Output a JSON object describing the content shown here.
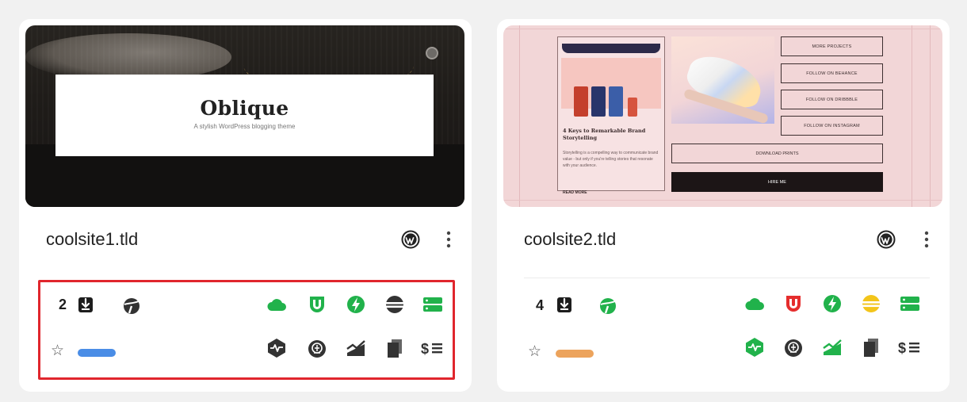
{
  "colors": {
    "green": "#21b24b",
    "dark": "#333333",
    "red": "#e52d2d",
    "yellow": "#f3c51a",
    "blue": "#4a8de6",
    "orange": "#eca35c",
    "highlight": "#e0262d"
  },
  "cards": [
    {
      "site": "coolsite1.tld",
      "thumbnail": {
        "logo": "Oblique",
        "tagline": "A stylish WordPress blogging theme"
      },
      "backup_count": "2",
      "label_color": "#4a8de6",
      "icons_row1": [
        "cloud-icon-green",
        "shield-icon-green",
        "bolt-icon-green",
        "striped-globe-icon-dark",
        "server-icon-green"
      ],
      "icons_row2": [
        "pulse-icon-dark",
        "brain-icon-dark",
        "trend-chart-icon-dark",
        "pages-icon-dark",
        "dollar-list-icon-dark"
      ]
    },
    {
      "site": "coolsite2.tld",
      "thumbnail": {
        "buttons": [
          "MORE PROJECTS",
          "FOLLOW ON BEHANCE",
          "FOLLOW ON DRIBBBLE",
          "FOLLOW ON INSTAGRAM"
        ],
        "download": "DOWNLOAD PRINTS",
        "hire": "HIRE ME",
        "post_title": "4 Keys to Remarkable Brand Storytelling",
        "post_text": "Storytelling is a compelling way to communicate brand value - but only if you're telling stories that resonate with your audience.",
        "read_more": "READ MORE"
      },
      "backup_count": "4",
      "label_color": "#eca35c",
      "icons_row1": [
        "cloud-icon-green",
        "shield-icon-red",
        "bolt-icon-green",
        "striped-globe-icon-yellow",
        "server-icon-green"
      ],
      "icons_row2": [
        "pulse-icon-green",
        "brain-icon-dark",
        "trend-chart-icon-green",
        "pages-icon-dark",
        "dollar-list-icon-dark"
      ]
    }
  ]
}
